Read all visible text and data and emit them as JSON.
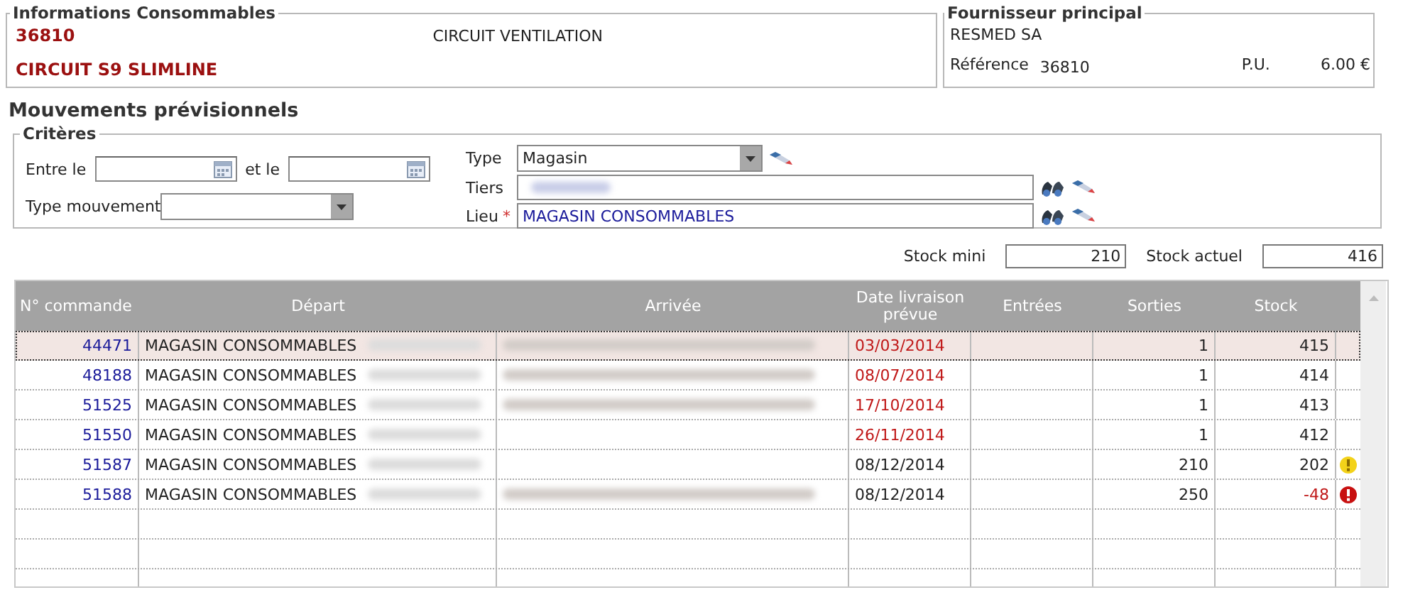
{
  "info": {
    "legend": "Informations Consommables",
    "code": "36810",
    "name": "CIRCUIT S9 SLIMLINE",
    "description": "CIRCUIT VENTILATION"
  },
  "supplier": {
    "legend": "Fournisseur principal",
    "name": "RESMED SA",
    "ref_label": "Référence",
    "ref_value": "36810",
    "price_label": "P.U.",
    "price_value": "6.00 €"
  },
  "section_title": "Mouvements prévisionnels",
  "criteria": {
    "legend": "Critères",
    "between_label": "Entre le",
    "and_label": "et le",
    "movement_type_label": "Type mouvement",
    "type_label": "Type",
    "type_value": "Magasin",
    "tiers_label": "Tiers",
    "tiers_redacted": true,
    "lieu_label": "Lieu",
    "lieu_required_marker": "*",
    "lieu_value": "MAGASIN CONSOMMABLES"
  },
  "stock": {
    "mini_label": "Stock mini",
    "mini_value": "210",
    "actual_label": "Stock actuel",
    "actual_value": "416"
  },
  "table": {
    "columns": [
      "N° commande",
      "Départ",
      "Arrivée",
      "Date livraison prévue",
      "Entrées",
      "Sorties",
      "Stock"
    ],
    "rows": [
      {
        "order": "44471",
        "departure": "MAGASIN CONSOMMABLES",
        "arrival_redacted": true,
        "date": "03/03/2014",
        "overdue": true,
        "sorties": "1",
        "stock": "415",
        "negative": false,
        "warning": false,
        "error": false,
        "selected": true
      },
      {
        "order": "48188",
        "departure": "MAGASIN CONSOMMABLES",
        "arrival_redacted": true,
        "date": "08/07/2014",
        "overdue": true,
        "sorties": "1",
        "stock": "414",
        "negative": false,
        "warning": false,
        "error": false,
        "selected": false
      },
      {
        "order": "51525",
        "departure": "MAGASIN CONSOMMABLES",
        "arrival_redacted": true,
        "date": "17/10/2014",
        "overdue": true,
        "sorties": "1",
        "stock": "413",
        "negative": false,
        "warning": false,
        "error": false,
        "selected": false
      },
      {
        "order": "51550",
        "departure": "MAGASIN CONSOMMABLES",
        "arrival_redacted": false,
        "date": "26/11/2014",
        "overdue": true,
        "sorties": "1",
        "stock": "412",
        "negative": false,
        "warning": false,
        "error": false,
        "selected": false
      },
      {
        "order": "51587",
        "departure": "MAGASIN CONSOMMABLES",
        "arrival_redacted": false,
        "date": "08/12/2014",
        "overdue": false,
        "sorties": "210",
        "stock": "202",
        "negative": false,
        "warning": true,
        "error": false,
        "selected": false
      },
      {
        "order": "51588",
        "departure": "MAGASIN CONSOMMABLES",
        "arrival_redacted": true,
        "date": "08/12/2014",
        "overdue": false,
        "sorties": "250",
        "stock": "-48",
        "negative": true,
        "warning": false,
        "error": true,
        "selected": false
      }
    ]
  }
}
